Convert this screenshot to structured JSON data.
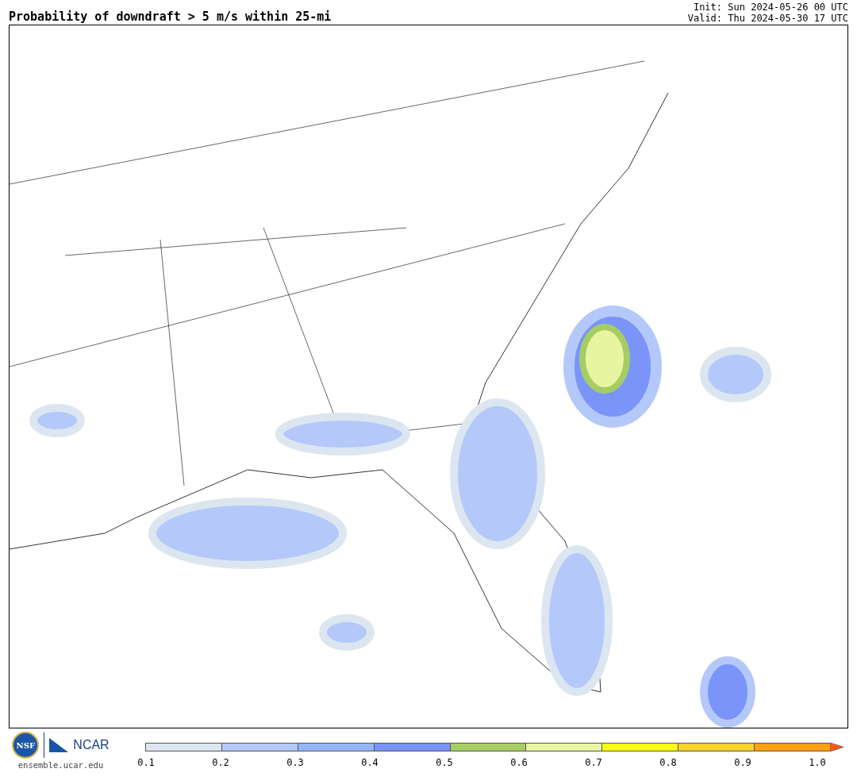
{
  "title": "Probability of downdraft > 5 m/s within 25-mi",
  "init": "Init: Sun 2024-05-26 00 UTC",
  "valid": "Valid: Thu 2024-05-30 17 UTC",
  "footer": {
    "logo_left": "NSF",
    "logo_right": "NCAR",
    "url": "ensemble.ucar.edu"
  },
  "colorbar": {
    "segments": [
      {
        "color": "#dce6f0"
      },
      {
        "color": "#b4c8fa"
      },
      {
        "color": "#96b4fa"
      },
      {
        "color": "#7a94fa"
      },
      {
        "color": "#a5cd64"
      },
      {
        "color": "#e8f5a0"
      },
      {
        "color": "#ffff14"
      },
      {
        "color": "#ffd228"
      },
      {
        "color": "#ffa014"
      }
    ],
    "extensions": [
      {
        "kind": "arrow",
        "color": "#ff5a14"
      }
    ],
    "ticks": [
      "0.1",
      "0.2",
      "0.3",
      "0.4",
      "0.5",
      "0.6",
      "0.7",
      "0.8",
      "0.9",
      "1.0"
    ]
  }
}
